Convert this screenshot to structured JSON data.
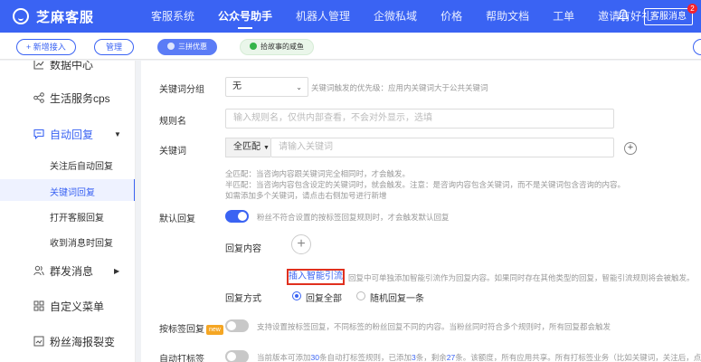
{
  "app": {
    "logo_text": "芝麻客服",
    "nav": [
      "客服系统",
      "公众号助手",
      "机器人管理",
      "企微私域",
      "价格",
      "帮助文档",
      "工单",
      "邀请有好礼"
    ],
    "message_button": "客服消息",
    "message_badge": "2",
    "accent_color": "#3a63f3"
  },
  "toolbar": {
    "new_access": "+ 新增接入",
    "manage": "管理",
    "promo": "三拼优惠",
    "story": "拾故事的咸鱼"
  },
  "sidebar": {
    "partial_top": "数据中心",
    "items": [
      {
        "label": "生活服务cps",
        "icon": "share-nodes-icon"
      },
      {
        "label": "自动回复",
        "icon": "chat-bubble-icon"
      }
    ],
    "sub_items": [
      "关注后自动回复",
      "关键词回复",
      "打开客服回复",
      "收到消息时回复"
    ],
    "active_sub": "关键词回复",
    "bottom_items": [
      {
        "label": "群发消息",
        "icon": "users-icon"
      },
      {
        "label": "自定义菜单",
        "icon": "grid-icon"
      },
      {
        "label": "粉丝海报裂变",
        "icon": "poster-icon"
      }
    ]
  },
  "form": {
    "group": {
      "label": "关键词分组",
      "value": "无",
      "hint": "关键词触发的优先级：应用内关键词大于公共关键词"
    },
    "rule_name": {
      "label": "规则名",
      "placeholder": "输入规则名，仅供内部查看，不会对外显示，选填"
    },
    "keyword": {
      "label": "关键词",
      "match_mode": "全匹配",
      "placeholder": "请输入关键词",
      "help": [
        "全匹配：当咨询内容跟关键词完全相同时，才会触发。",
        "半匹配：当咨询内容包含设定的关键词时，就会触发。注意：是咨询内容包含关键词，而不是关键词包含咨询的内容。",
        "如需添加多个关键词，请点击右侧加号进行新增"
      ]
    },
    "default_reply": {
      "label": "默认回复",
      "enabled": true,
      "hint": "粉丝不符合设置的按标签回复规则时，才会触发默认回复"
    },
    "reply_content": {
      "label": "回复内容",
      "insert_link": "插入智能引流",
      "insert_hint": "回复中可单独添加智能引流作为回复内容。如果同时存在其他类型的回复，智能引流规则将会被触发。"
    },
    "reply_mode": {
      "label": "回复方式",
      "options": [
        "回复全部",
        "随机回复一条"
      ],
      "selected": "回复全部"
    },
    "tag_reply": {
      "label": "按标签回复",
      "tag": "new",
      "enabled": false,
      "hint": "支持设置按标签回复，不同标签的粉丝回复不同的内容。当粉丝同时符合多个规则时，所有回复都会触发"
    },
    "auto_tag": {
      "label": "自动打标签",
      "enabled": false,
      "hint_pre": "当前版本可添加",
      "hint_limit": "30",
      "hint_mid1": "条自动打标签规则，已添加",
      "hint_added": "3",
      "hint_mid2": "条，剩余",
      "hint_left": "27",
      "hint_post": "条。该额度，所有应用共享。所有打标签业务（比如关键词，关注后，点菜单等）"
    }
  }
}
